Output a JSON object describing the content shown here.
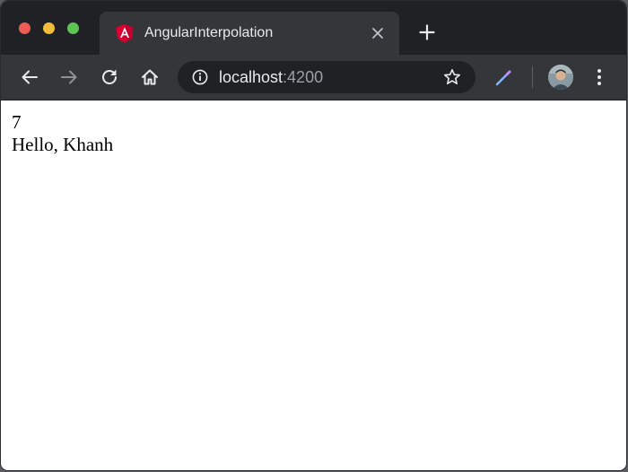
{
  "browser": {
    "tab": {
      "title": "AngularInterpolation",
      "favicon": "angular-icon"
    },
    "address_bar": {
      "host": "localhost",
      "port": ":4200"
    },
    "icons": {
      "back": "back-arrow-icon",
      "forward": "forward-arrow-icon",
      "reload": "reload-icon",
      "home": "home-icon",
      "info": "info-icon",
      "bookmark": "star-icon",
      "extension": "eyedropper-icon",
      "menu": "kebab-menu-icon",
      "new_tab": "plus-icon",
      "close_tab": "close-icon"
    },
    "colors": {
      "titlebar": "#202124",
      "toolbar": "#35363a",
      "angular_red": "#dd0031"
    }
  },
  "page": {
    "lines": [
      "7",
      "Hello, Khanh"
    ]
  }
}
